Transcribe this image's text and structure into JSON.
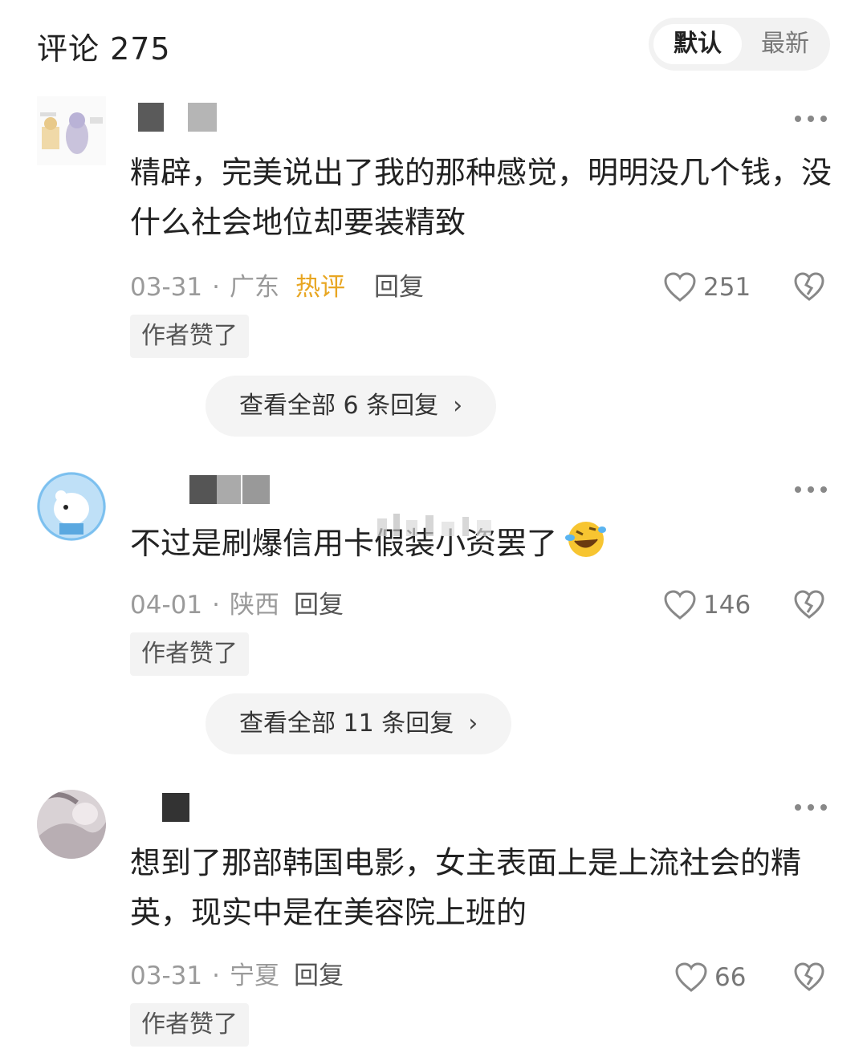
{
  "header": {
    "title": "评论 275",
    "sort_default": "默认",
    "sort_latest": "最新"
  },
  "comments": [
    {
      "text": "精辟，完美说出了我的那种感觉，明明没几个钱，没什么社会地位却要装精致",
      "date": "03-31",
      "location": "广东",
      "hot_tag": "热评",
      "reply_label": "回复",
      "likes": "251",
      "author_liked": "作者赞了",
      "view_replies": "查看全部 6 条回复"
    },
    {
      "text": "不过是刷爆信用卡假装小资罢了",
      "emoji": "rolling-laughing-emoji",
      "date": "04-01",
      "location": "陕西",
      "reply_label": "回复",
      "likes": "146",
      "author_liked": "作者赞了",
      "view_replies": "查看全部 11 条回复"
    },
    {
      "text": "想到了那部韩国电影，女主表面上是上流社会的精英，现实中是在美容院上班的",
      "date": "03-31",
      "location": "宁夏",
      "reply_label": "回复",
      "likes": "66",
      "author_liked": "作者赞了"
    }
  ],
  "icons": {
    "more": "more-dots-icon",
    "like": "heart-outline-icon",
    "dislike": "broken-heart-icon",
    "chevron": "›"
  },
  "colors": {
    "hot_tag": "#e8a622",
    "meta": "#9a9a9a",
    "pill_bg": "#f4f4f4"
  }
}
